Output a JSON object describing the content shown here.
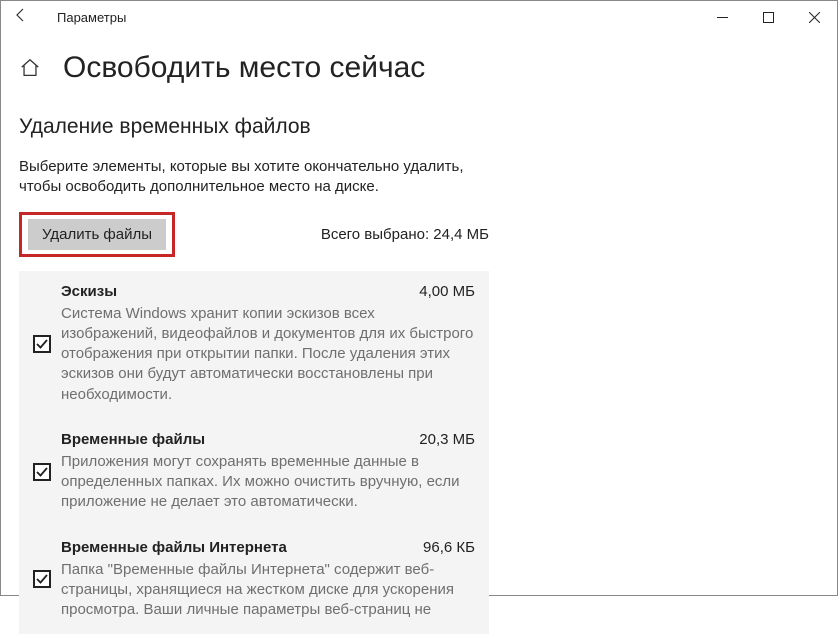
{
  "window": {
    "title": "Параметры"
  },
  "page": {
    "title": "Освободить место сейчас",
    "section_title": "Удаление временных файлов",
    "description": "Выберите элементы, которые вы хотите окончательно удалить, чтобы освободить дополнительное место на диске.",
    "remove_button": "Удалить файлы",
    "total_label": "Всего выбрано: 24,4 МБ"
  },
  "items": [
    {
      "title": "Эскизы",
      "size": "4,00 МБ",
      "checked": true,
      "description": "Система Windows хранит копии эскизов всех изображений, видеофайлов и документов для их быстрого отображения при открытии папки. После удаления этих эскизов они будут автоматически восстановлены при необходимости."
    },
    {
      "title": "Временные файлы",
      "size": "20,3 МБ",
      "checked": true,
      "description": "Приложения могут сохранять временные данные в определенных папках. Их можно очистить вручную, если приложение не делает это автоматически."
    },
    {
      "title": "Временные файлы Интернета",
      "size": "96,6 КБ",
      "checked": true,
      "description": "Папка \"Временные файлы Интернета\" содержит веб-страницы, хранящиеся на жестком диске для ускорения просмотра. Ваши личные параметры веб-страниц не"
    }
  ]
}
